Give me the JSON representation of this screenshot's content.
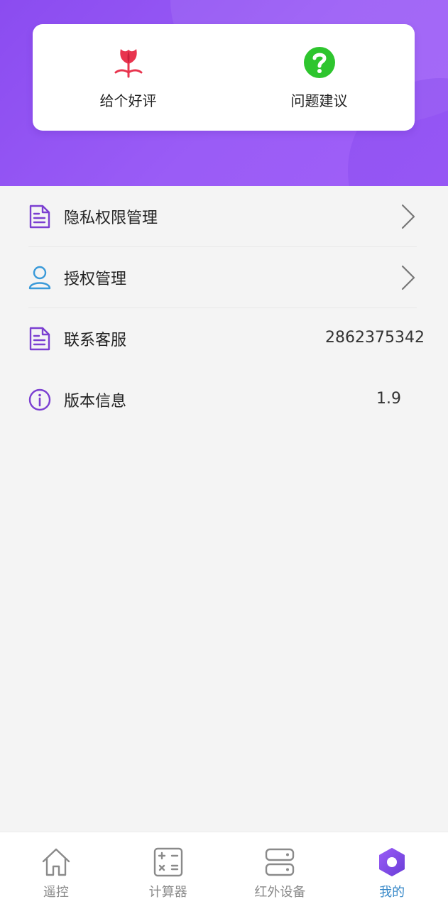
{
  "header": {
    "actions": [
      {
        "label": "给个好评",
        "icon": "tulip-icon"
      },
      {
        "label": "问题建议",
        "icon": "question-icon"
      }
    ]
  },
  "menu": {
    "items": [
      {
        "label": "隐私权限管理",
        "icon": "document-icon",
        "value": ""
      },
      {
        "label": "授权管理",
        "icon": "user-icon",
        "value": ""
      },
      {
        "label": "联系客服",
        "icon": "document-icon",
        "value": "2862375342"
      },
      {
        "label": "版本信息",
        "icon": "info-icon",
        "value": "1.9"
      }
    ]
  },
  "tabbar": {
    "tabs": [
      {
        "label": "遥控",
        "icon": "home-icon",
        "active": false
      },
      {
        "label": "计算器",
        "icon": "calculator-icon",
        "active": false
      },
      {
        "label": "红外设备",
        "icon": "server-icon",
        "active": false
      },
      {
        "label": "我的",
        "icon": "hexagon-icon",
        "active": true
      }
    ]
  },
  "colors": {
    "header_purple": "#9254f4",
    "icon_purple": "#7b3fd1",
    "icon_blue": "#3a9ad9",
    "tulip_red": "#e8344e",
    "question_green": "#2ec52e",
    "active_tab": "#3a8ac9"
  }
}
